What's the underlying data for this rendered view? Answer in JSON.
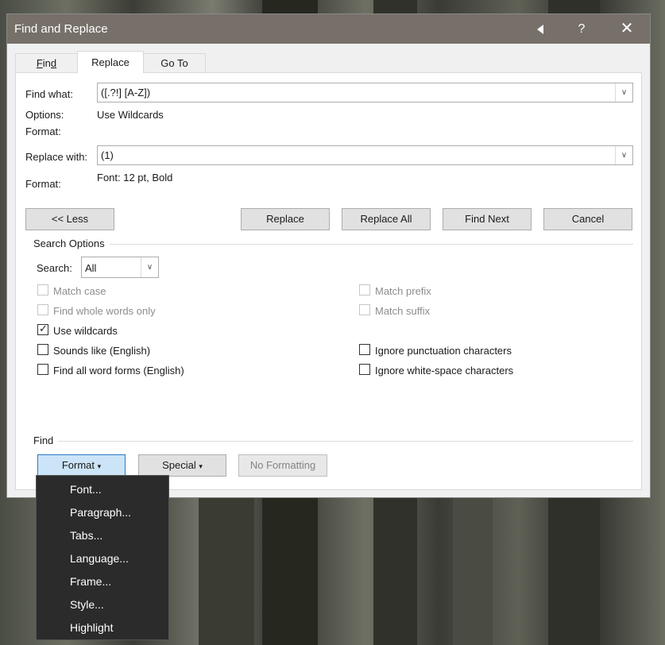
{
  "window": {
    "title": "Find and Replace",
    "back_icon": "triangle-left-icon",
    "help_label": "?",
    "close_label": "✕"
  },
  "tabs": [
    {
      "label": "Find",
      "selected": false
    },
    {
      "label": "Replace",
      "selected": true
    },
    {
      "label": "Go To",
      "selected": false
    }
  ],
  "find": {
    "label": "Find what:",
    "value": "([.?!] [A-Z])",
    "options_label": "Options:",
    "options_value": "Use Wildcards",
    "format_label": "Format:"
  },
  "replace": {
    "label": "Replace with:",
    "value": "(1)",
    "format_label": "Format:",
    "format_value": "Font: 12 pt, Bold"
  },
  "buttons": {
    "less": "<< Less",
    "replace": "Replace",
    "replace_all": "Replace All",
    "find_next": "Find Next",
    "cancel": "Cancel"
  },
  "search_options": {
    "title": "Search Options",
    "search_label": "Search:",
    "search_value": "All",
    "left": [
      {
        "label": "Match case",
        "checked": false,
        "enabled": false
      },
      {
        "label": "Find whole words only",
        "checked": false,
        "enabled": false
      },
      {
        "label": "Use wildcards",
        "checked": true,
        "enabled": true
      },
      {
        "label": "Sounds like (English)",
        "checked": false,
        "enabled": true
      },
      {
        "label": "Find all word forms (English)",
        "checked": false,
        "enabled": true
      }
    ],
    "right": [
      {
        "label": "Match prefix",
        "checked": false,
        "enabled": false
      },
      {
        "label": "Match suffix",
        "checked": false,
        "enabled": false
      },
      {
        "label": "Ignore punctuation characters",
        "checked": false,
        "enabled": true
      },
      {
        "label": "Ignore white-space characters",
        "checked": false,
        "enabled": true
      }
    ]
  },
  "find_section": {
    "title": "Find",
    "format_button": "Format",
    "special_button": "Special",
    "no_formatting_button": "No Formatting"
  },
  "format_menu": [
    "Font...",
    "Paragraph...",
    "Tabs...",
    "Language...",
    "Frame...",
    "Style...",
    "Highlight"
  ]
}
